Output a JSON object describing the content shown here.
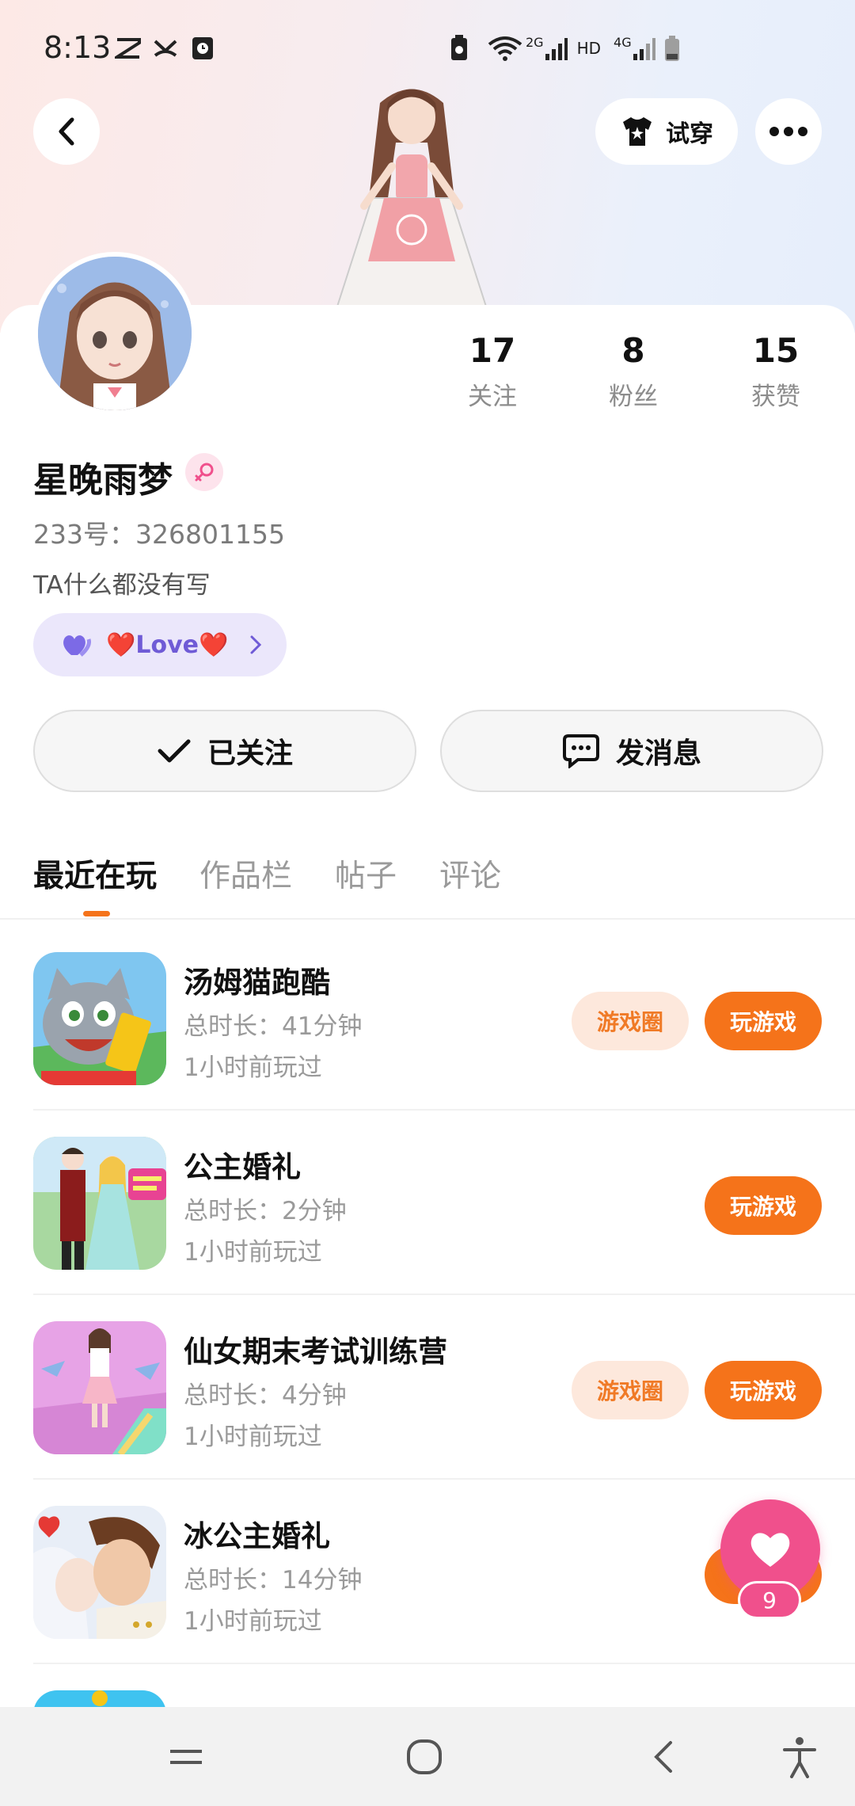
{
  "status_bar": {
    "time": "8:13",
    "network_labels": [
      "2G",
      "HD",
      "4G"
    ]
  },
  "header": {
    "try_on_label": "试穿",
    "back_icon": "chevron-left-icon",
    "more_icon": "more-dots-icon"
  },
  "profile": {
    "name": "星晚雨梦",
    "gender": "female",
    "uid": "233号：326801155",
    "bio": "TA什么都没有写",
    "love_tag": "❤️Love❤️",
    "stats": [
      {
        "value": "17",
        "label": "关注"
      },
      {
        "value": "8",
        "label": "粉丝"
      },
      {
        "value": "15",
        "label": "获赞"
      }
    ]
  },
  "actions": {
    "follow_label": "已关注",
    "message_label": "发消息"
  },
  "tabs": [
    {
      "label": "最近在玩",
      "active": true
    },
    {
      "label": "作品栏",
      "active": false
    },
    {
      "label": "帖子",
      "active": false
    },
    {
      "label": "评论",
      "active": false
    }
  ],
  "games": [
    {
      "title": "汤姆猫跑酷",
      "duration": "总时长：41分钟",
      "last_played": "1小时前玩过",
      "circle_label": "游戏圈",
      "play_label": "玩游戏"
    },
    {
      "title": "公主婚礼",
      "duration": "总时长：2分钟",
      "last_played": "1小时前玩过",
      "circle_label": "",
      "play_label": "玩游戏"
    },
    {
      "title": "仙女期末考试训练营",
      "duration": "总时长：4分钟",
      "last_played": "1小时前玩过",
      "circle_label": "游戏圈",
      "play_label": "玩游戏"
    },
    {
      "title": "冰公主婚礼",
      "duration": "总时长：14分钟",
      "last_played": "1小时前玩过",
      "circle_label": "",
      "play_label": ""
    }
  ],
  "fab": {
    "icon": "heart-icon",
    "count": "9"
  },
  "colors": {
    "accent": "#f5731a",
    "fab": "#f0508c",
    "love_tag_bg": "#ebe7fb"
  }
}
